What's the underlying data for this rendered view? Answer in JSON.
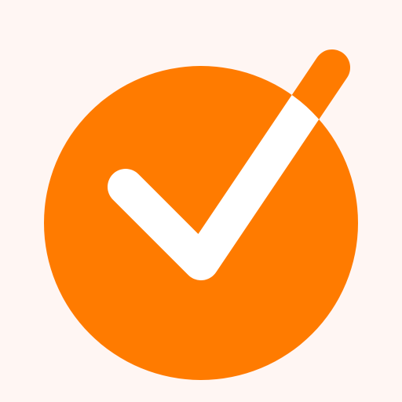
{
  "logo": {
    "icon": "check-circle-icon",
    "colors": {
      "background": "#FFF6F3",
      "circle": "#FF7B00",
      "check": "#FFFFFF",
      "check_extension": "#FF7B00"
    }
  }
}
